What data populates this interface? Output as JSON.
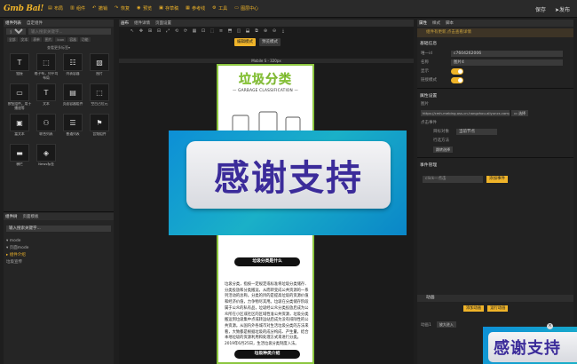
{
  "app": {
    "logo": "Gmb Bai!"
  },
  "menu": [
    {
      "icon": "▤",
      "label": "布局"
    },
    {
      "icon": "▥",
      "label": "组件"
    },
    {
      "icon": "↶",
      "label": "撤销"
    },
    {
      "icon": "↷",
      "label": "恢复"
    },
    {
      "icon": "◉",
      "label": "预览"
    },
    {
      "icon": "▣",
      "label": "存草稿"
    },
    {
      "icon": "▦",
      "label": "参考线"
    },
    {
      "icon": "⚙",
      "label": "工具"
    },
    {
      "icon": "▭",
      "label": "图层中心"
    }
  ],
  "top_right": {
    "save": "保存",
    "publish": "发布"
  },
  "left_panel": {
    "tabs": [
      "组件列表",
      "自定组件"
    ],
    "search_placeholder": "输入搜索关键字...",
    "filters": [
      "全部",
      "文本",
      "表单",
      "图片",
      "Icon",
      "容器",
      "功能"
    ],
    "more": "查看更多标签▾",
    "components": [
      {
        "icon": "T",
        "label": "链接"
      },
      {
        "icon": "⬚",
        "label": "格子布，列平均布局"
      },
      {
        "icon": "☷",
        "label": "列表容器"
      },
      {
        "icon": "▧",
        "label": "图片"
      },
      {
        "icon": "▭",
        "label": "按钮组件，用于播放等"
      },
      {
        "icon": "T",
        "label": "文本"
      },
      {
        "icon": "▤",
        "label": "页面容器组件"
      },
      {
        "icon": "⬚",
        "label": "空白占位元"
      },
      {
        "icon": "▣",
        "label": "富文本"
      },
      {
        "icon": "⚇",
        "label": "联合列表"
      },
      {
        "icon": "☰",
        "label": "普通列表"
      },
      {
        "icon": "⚑",
        "label": "音频组件"
      },
      {
        "icon": "▬",
        "label": "横栏"
      },
      {
        "icon": "◈",
        "label": "News标签"
      }
    ]
  },
  "tree_panel": {
    "tabs": [
      "组件树",
      "页面模板"
    ],
    "search": "输入搜索关键字...",
    "nodes": [
      {
        "label": "▾ mode",
        "selected": false
      },
      {
        "label": "  ▾ 页面mode",
        "selected": false
      },
      {
        "label": "    ▸ 组件介绍",
        "selected": true
      },
      {
        "label": "      垃圾宣传",
        "selected": false
      }
    ]
  },
  "center_panel": {
    "tabs": [
      "画布",
      "组件详情",
      "页面设置"
    ],
    "tools": [
      "↖",
      "✥",
      "⊞",
      "⊟",
      "⤢",
      "⟲",
      "⟳",
      "▦",
      "⊡",
      "⬚",
      "≡",
      "⬒",
      "◫",
      "⬓",
      "⧉",
      "⊕",
      "⊖",
      "⤓"
    ],
    "modes": {
      "active": "编辑模式",
      "normal": "预览模式"
    },
    "canvas_label": "Mobile S - 320px"
  },
  "phone": {
    "title": "垃圾分类",
    "subtitle": "— GARBAGE CLASSIFICATION —",
    "heading1": "垃圾分类是什么",
    "body": "垃圾分类，指按一定规定或标准将垃圾分类储存、分类投放和分类搬运，从而转变成公共资源的一系列活动的总称。分类的目的是提高垃圾的资源价值和经济价值，力争物尽其用。垃圾在分类储存阶段属于公众的私有品，垃圾经公众分类投放后成为公众所在小区或社区的区域性准公共资源，垃圾分类搬运到垃圾集中点或转运站后成为没有排除性的公共资源。从国内外各城市对生活垃圾分类的方法来看，大致都是根据垃圾的成分构成、产生量，结合本地垃圾的资源利用和处理方式来进行分类。2019年6月25日，生活垃圾分类制度入法。",
    "heading2": "垃圾种类介绍"
  },
  "right_panel": {
    "tabs": [
      "属性",
      "样式",
      "脚本"
    ],
    "notice": "组件有更新,点击查看详情",
    "basic_title": "基础信息",
    "fields": [
      {
        "label": "唯一id",
        "value": "c7604262006"
      },
      {
        "label": "名称",
        "value": "图片4"
      }
    ],
    "toggles": [
      {
        "label": "显示"
      },
      {
        "label": "链接模式"
      }
    ],
    "attr_title": "属性设置",
    "image_label": "图片",
    "image_url": "https://cmh-mebing.oss-cn-hangzhou.aliyuncs.com/f",
    "choose": "选择",
    "click_event": "点击事件",
    "target_label": "目标对象",
    "target_value": "当前节点",
    "action_label": "行选方法",
    "action_chip": "跳转选择",
    "event_title": "事件管理",
    "event_placeholder": "click—点击",
    "add_event": "添加事件",
    "anim_title": "动画",
    "anim_add": "添加动画",
    "anim_run": "运行动画",
    "anim_item_label": "动画1",
    "anim_item_value": "放大进入"
  },
  "overlay": {
    "text": "感谢支持",
    "small_text": "感谢支持",
    "close": "×"
  },
  "colors": {
    "accent": "#f0b429",
    "banner_blue": "#0d8fd6",
    "banner_text": "#3b2b9a",
    "phone_border": "#8cc63f"
  }
}
